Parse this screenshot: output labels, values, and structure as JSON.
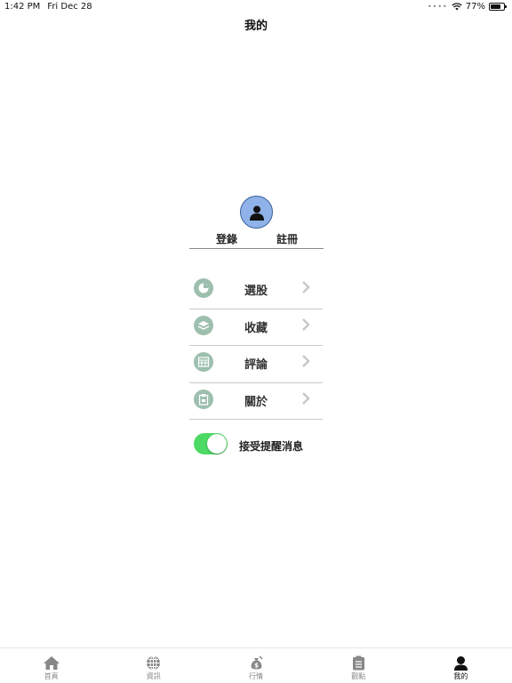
{
  "status_bar": {
    "time": "1:42 PM",
    "date": "Fri Dec 28",
    "battery": "77%",
    "battery_level": 0.77
  },
  "nav": {
    "title": "我的"
  },
  "profile": {
    "login_label": "登錄",
    "register_label": "註冊"
  },
  "menu": [
    {
      "label": "選股",
      "icon": "pie-chart-icon"
    },
    {
      "label": "收藏",
      "icon": "layers-icon"
    },
    {
      "label": "評論",
      "icon": "calendar-grid-icon"
    },
    {
      "label": "關於",
      "icon": "clipboard-icon"
    }
  ],
  "notification": {
    "label": "接受提醒消息",
    "enabled": true
  },
  "tabs": [
    {
      "label": "首頁",
      "icon": "home-icon",
      "active": false
    },
    {
      "label": "資訊",
      "icon": "globe-icon",
      "active": false
    },
    {
      "label": "行情",
      "icon": "money-bag-icon",
      "active": false
    },
    {
      "label": "觀點",
      "icon": "clipboard-list-icon",
      "active": false
    },
    {
      "label": "我的",
      "icon": "user-icon",
      "active": true
    }
  ],
  "colors": {
    "avatar_bg": "#8fb2e8",
    "menu_icon_bg": "#9dbfae",
    "toggle_on": "#4cd964"
  }
}
